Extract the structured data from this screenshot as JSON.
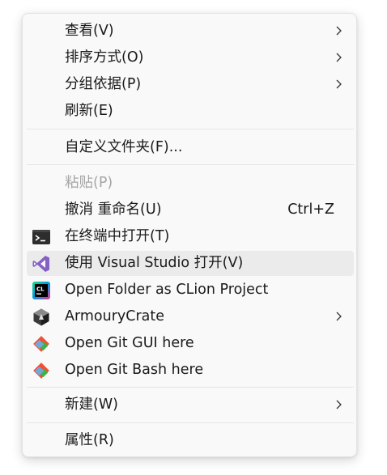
{
  "menu": {
    "items": [
      {
        "label": "查看(V)"
      },
      {
        "label": "排序方式(O)"
      },
      {
        "label": "分组依据(P)"
      },
      {
        "label": "刷新(E)"
      },
      {
        "label": "自定义文件夹(F)..."
      },
      {
        "label": "粘贴(P)",
        "disabled": true
      },
      {
        "label": "撤消 重命名(U)",
        "shortcut": "Ctrl+Z"
      },
      {
        "label": "在终端中打开(T)",
        "icon": "terminal-icon"
      },
      {
        "label": "使用 Visual Studio 打开(V)",
        "icon": "visual-studio-icon",
        "hovered": true
      },
      {
        "label": "Open Folder as CLion Project",
        "icon": "clion-icon"
      },
      {
        "label": "ArmouryCrate",
        "icon": "armoury-crate-icon"
      },
      {
        "label": "Open Git GUI here",
        "icon": "git-icon"
      },
      {
        "label": "Open Git Bash here",
        "icon": "git-icon"
      },
      {
        "label": "新建(W)"
      },
      {
        "label": "属性(R)"
      }
    ],
    "icons": {
      "cl_text": "CL"
    },
    "colors": {
      "vs_purple": "#8661c5",
      "git_red": "#f05133",
      "hover_bg": "#ebebeb",
      "disabled_text": "#a6a6a6"
    }
  }
}
